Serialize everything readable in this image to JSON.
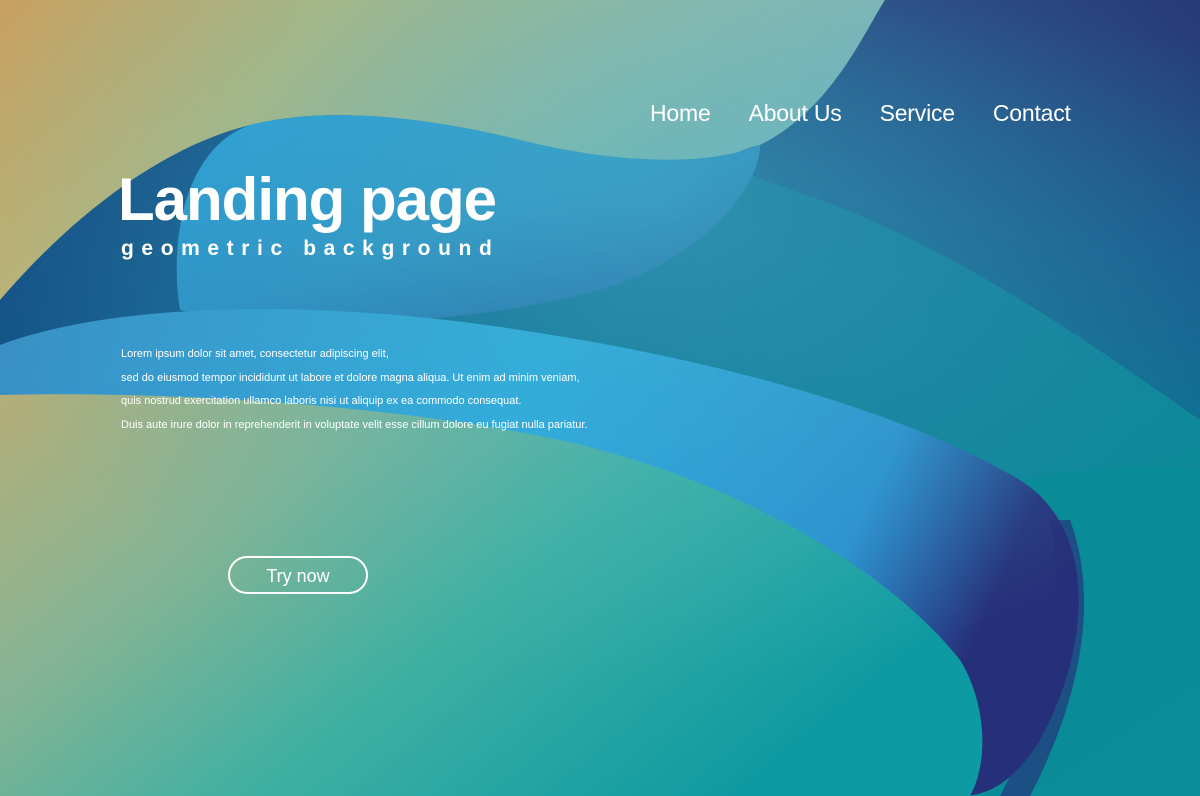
{
  "nav": {
    "items": [
      {
        "label": "Home"
      },
      {
        "label": "About Us"
      },
      {
        "label": "Service"
      },
      {
        "label": "Contact"
      }
    ]
  },
  "hero": {
    "title": "Landing page",
    "subtitle": "geometric background",
    "body_lines": [
      "Lorem ipsum dolor sit amet, consectetur adipiscing elit,",
      "sed do eiusmod tempor incididunt ut labore et dolore magna aliqua. Ut enim ad minim veniam,",
      "quis nostrud exercitation ullamco laboris nisi ut aliquip ex ea commodo consequat.",
      "Duis aute irure dolor in reprehenderit in voluptate velit esse cillum dolore eu fugiat nulla pariatur."
    ],
    "cta_label": "Try now"
  },
  "colors": {
    "deep_navy": "#28246a",
    "teal": "#0a8e9a",
    "sky_blue": "#2aa8e2",
    "olive_yellow": "#c4b878",
    "text": "#ffffff"
  }
}
